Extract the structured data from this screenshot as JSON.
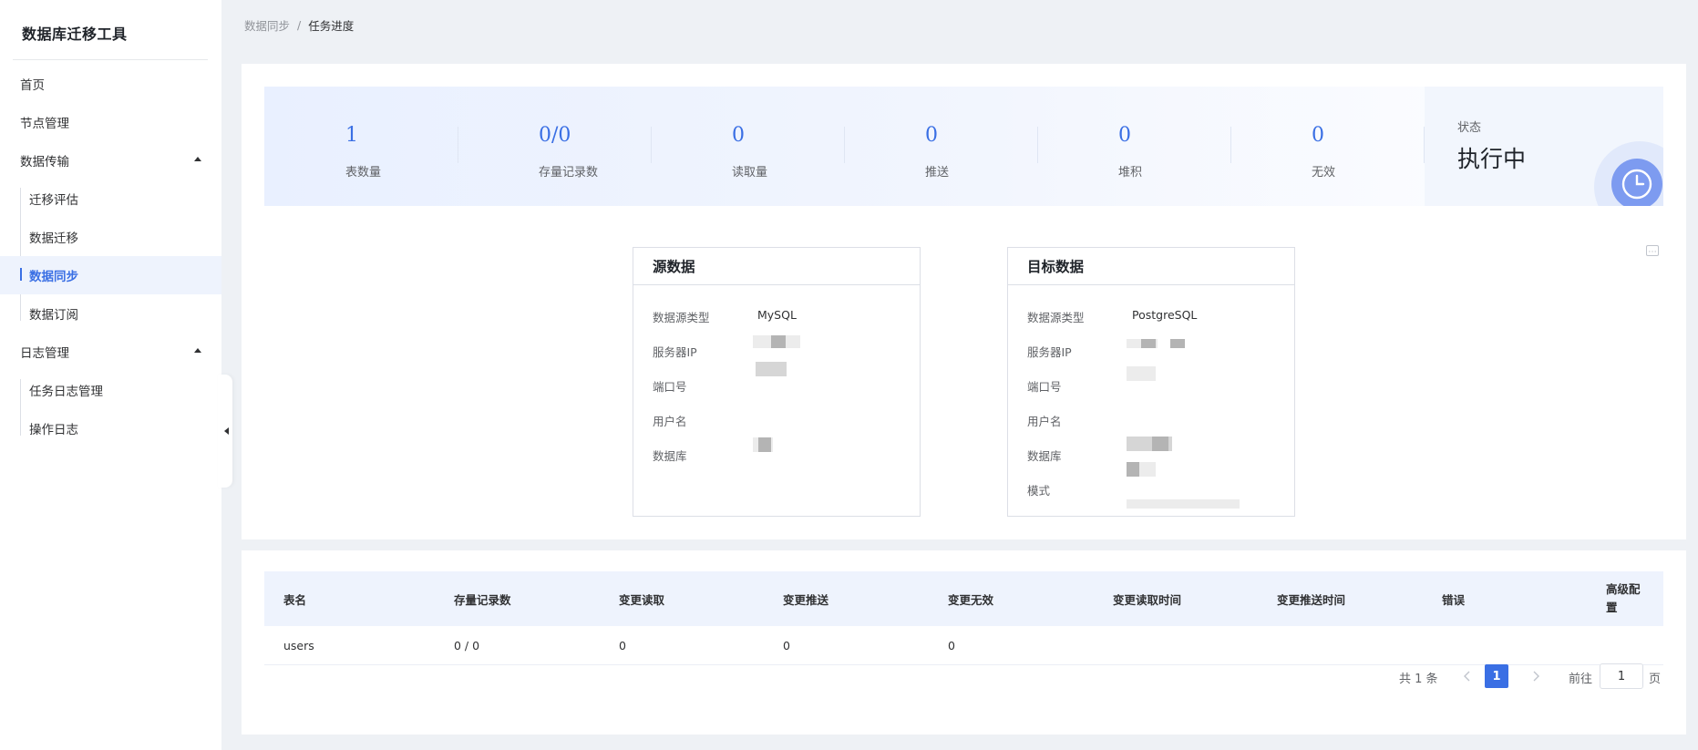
{
  "app": {
    "title": "数据库迁移工具"
  },
  "sidebar": {
    "items": [
      {
        "label": "首页"
      },
      {
        "label": "节点管理"
      },
      {
        "label": "数据传输",
        "children": [
          "迁移评估",
          "数据迁移",
          "数据同步",
          "数据订阅"
        ]
      },
      {
        "label": "日志管理",
        "children": [
          "任务日志管理",
          "操作日志"
        ]
      }
    ],
    "active": "数据同步"
  },
  "breadcrumb": {
    "parent": "数据同步",
    "separator": "/",
    "current": "任务进度"
  },
  "stats": [
    {
      "value": "1",
      "label": "表数量"
    },
    {
      "value": "0/0",
      "label": "存量记录数"
    },
    {
      "value": "0",
      "label": "读取量"
    },
    {
      "value": "0",
      "label": "推送"
    },
    {
      "value": "0",
      "label": "堆积"
    },
    {
      "value": "0",
      "label": "无效"
    }
  ],
  "status": {
    "label": "状态",
    "value": "执行中"
  },
  "source": {
    "title": "源数据",
    "fields": [
      {
        "label": "数据源类型",
        "value": "MySQL"
      },
      {
        "label": "服务器IP",
        "value": ""
      },
      {
        "label": "端口号",
        "value": ""
      },
      {
        "label": "用户名",
        "value": ""
      },
      {
        "label": "数据库",
        "value": ""
      }
    ]
  },
  "target": {
    "title": "目标数据",
    "fields": [
      {
        "label": "数据源类型",
        "value": "PostgreSQL"
      },
      {
        "label": "服务器IP",
        "value": ""
      },
      {
        "label": "端口号",
        "value": ""
      },
      {
        "label": "用户名",
        "value": ""
      },
      {
        "label": "数据库",
        "value": ""
      },
      {
        "label": "模式",
        "value": ""
      }
    ]
  },
  "table": {
    "columns": [
      "表名",
      "存量记录数",
      "变更读取",
      "变更推送",
      "变更无效",
      "变更读取时间",
      "变更推送时间",
      "错误",
      "高级配置"
    ],
    "rows": [
      [
        "users",
        "0 / 0",
        "0",
        "0",
        "0",
        "",
        "",
        "",
        ""
      ]
    ]
  },
  "pagination": {
    "total_text": "共 1 条",
    "current_page": "1",
    "goto_label": "前往",
    "goto_value": "1",
    "page_suffix": "页"
  },
  "colors": {
    "accent": "#3a6fe4",
    "background": "#eef1f5",
    "active_bg": "#eef3fd"
  }
}
